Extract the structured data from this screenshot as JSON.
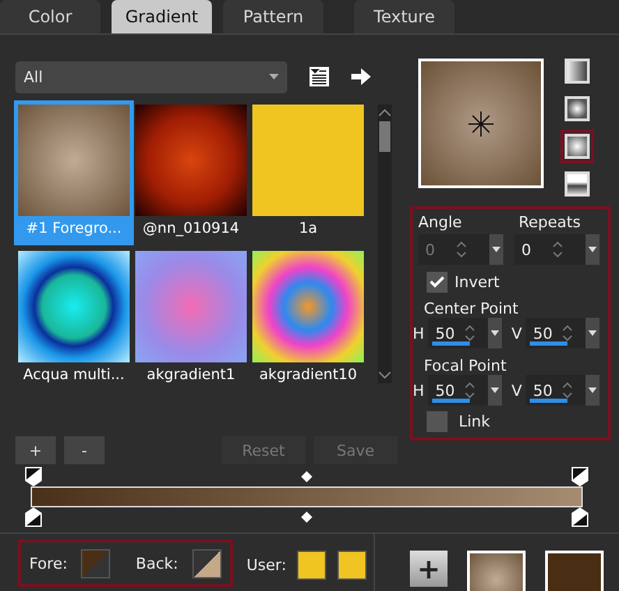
{
  "tabs": [
    {
      "label": "Color",
      "selected": false
    },
    {
      "label": "Gradient",
      "selected": true
    },
    {
      "label": "Pattern",
      "selected": false
    },
    {
      "label": "Texture",
      "selected": false
    }
  ],
  "category": {
    "value": "All"
  },
  "gradients": [
    {
      "name": "#1 Foregro...",
      "selected": true,
      "kind": "beige"
    },
    {
      "name": "@nn_010914",
      "selected": false,
      "kind": "ember"
    },
    {
      "name": "1a",
      "selected": false,
      "kind": "yellow"
    },
    {
      "name": "Acqua multi...",
      "selected": false,
      "kind": "aqua"
    },
    {
      "name": "akgradient1",
      "selected": false,
      "kind": "pastel"
    },
    {
      "name": "akgradient10",
      "selected": false,
      "kind": "rainbow"
    }
  ],
  "styles": [
    {
      "kind": "linear",
      "selected": false
    },
    {
      "kind": "rectangular",
      "selected": false
    },
    {
      "kind": "radial",
      "selected": true
    },
    {
      "kind": "sunburst",
      "selected": false
    }
  ],
  "angle": {
    "label": "Angle",
    "value": "0",
    "disabled": true
  },
  "repeats": {
    "label": "Repeats",
    "value": "0",
    "disabled": false
  },
  "invert": {
    "label": "Invert",
    "checked": true
  },
  "center_point": {
    "label": "Center Point",
    "h": {
      "label": "H",
      "value": "50",
      "level": 0.5
    },
    "v": {
      "label": "V",
      "value": "50",
      "level": 0.5
    }
  },
  "focal_point": {
    "label": "Focal Point",
    "h": {
      "label": "H",
      "value": "50",
      "level": 0.5
    },
    "v": {
      "label": "V",
      "value": "50",
      "level": 0.5
    }
  },
  "link": {
    "label": "Link",
    "checked": false
  },
  "buttons": [
    {
      "label": "+",
      "disabled": false
    },
    {
      "label": "-",
      "disabled": false
    },
    {
      "label": "Reset",
      "disabled": true
    },
    {
      "label": "Save",
      "disabled": true
    }
  ],
  "fore": {
    "label": "Fore:"
  },
  "back": {
    "label": "Back:"
  },
  "user": {
    "label": "User:"
  },
  "add": {
    "label": "+"
  }
}
